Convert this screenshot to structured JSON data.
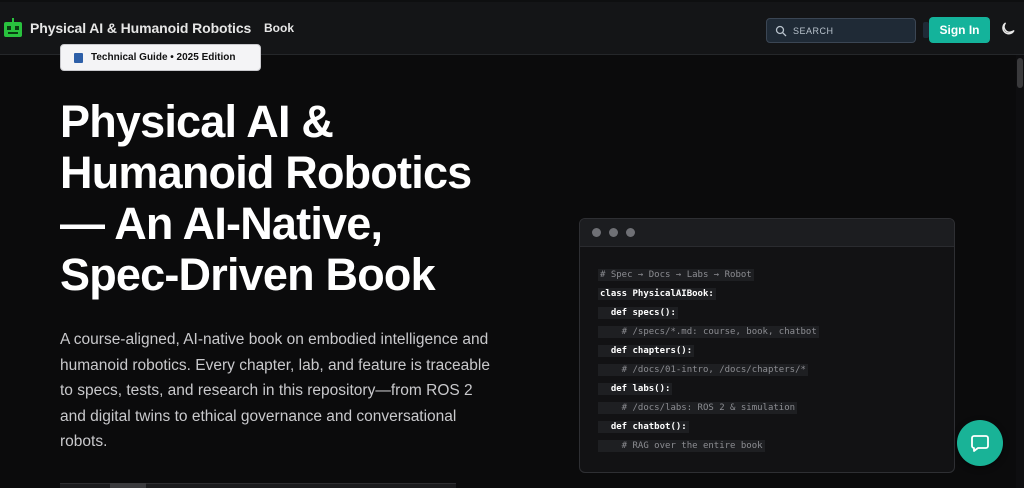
{
  "navbar": {
    "brand": "Physical AI & Humanoid Robotics",
    "book_link": "Book",
    "search_placeholder": "SEARCH",
    "signin_label": "Sign In",
    "theme_icon": "moon-icon",
    "accent": "#14b39b"
  },
  "badge": {
    "text": "Technical Guide • 2025 Edition",
    "icon": "book-icon"
  },
  "hero": {
    "title_lines": [
      "Physical AI &",
      "Humanoid Robotics",
      "— An AI-Native,",
      "Spec-Driven Book"
    ],
    "description": "A course-aligned, AI-native book on embodied intelligence and humanoid robotics. Every chapter, lab, and feature is traceable to specs, tests, and research in this repository—from ROS 2 and digital twins to ethical governance and conversational robots."
  },
  "code": {
    "lines": [
      "# Spec → Docs → Labs → Robot",
      "class PhysicalAIBook:",
      "  def specs():",
      "    # /specs/*.md: course, book, chatbot",
      "  def chapters():",
      "    # /docs/01-intro, /docs/chapters/*",
      "  def labs():",
      "    # /docs/labs: ROS 2 & simulation",
      "  def chatbot():",
      "    # RAG over the entire book"
    ]
  },
  "chat": {
    "icon": "chat-bubble-icon"
  }
}
